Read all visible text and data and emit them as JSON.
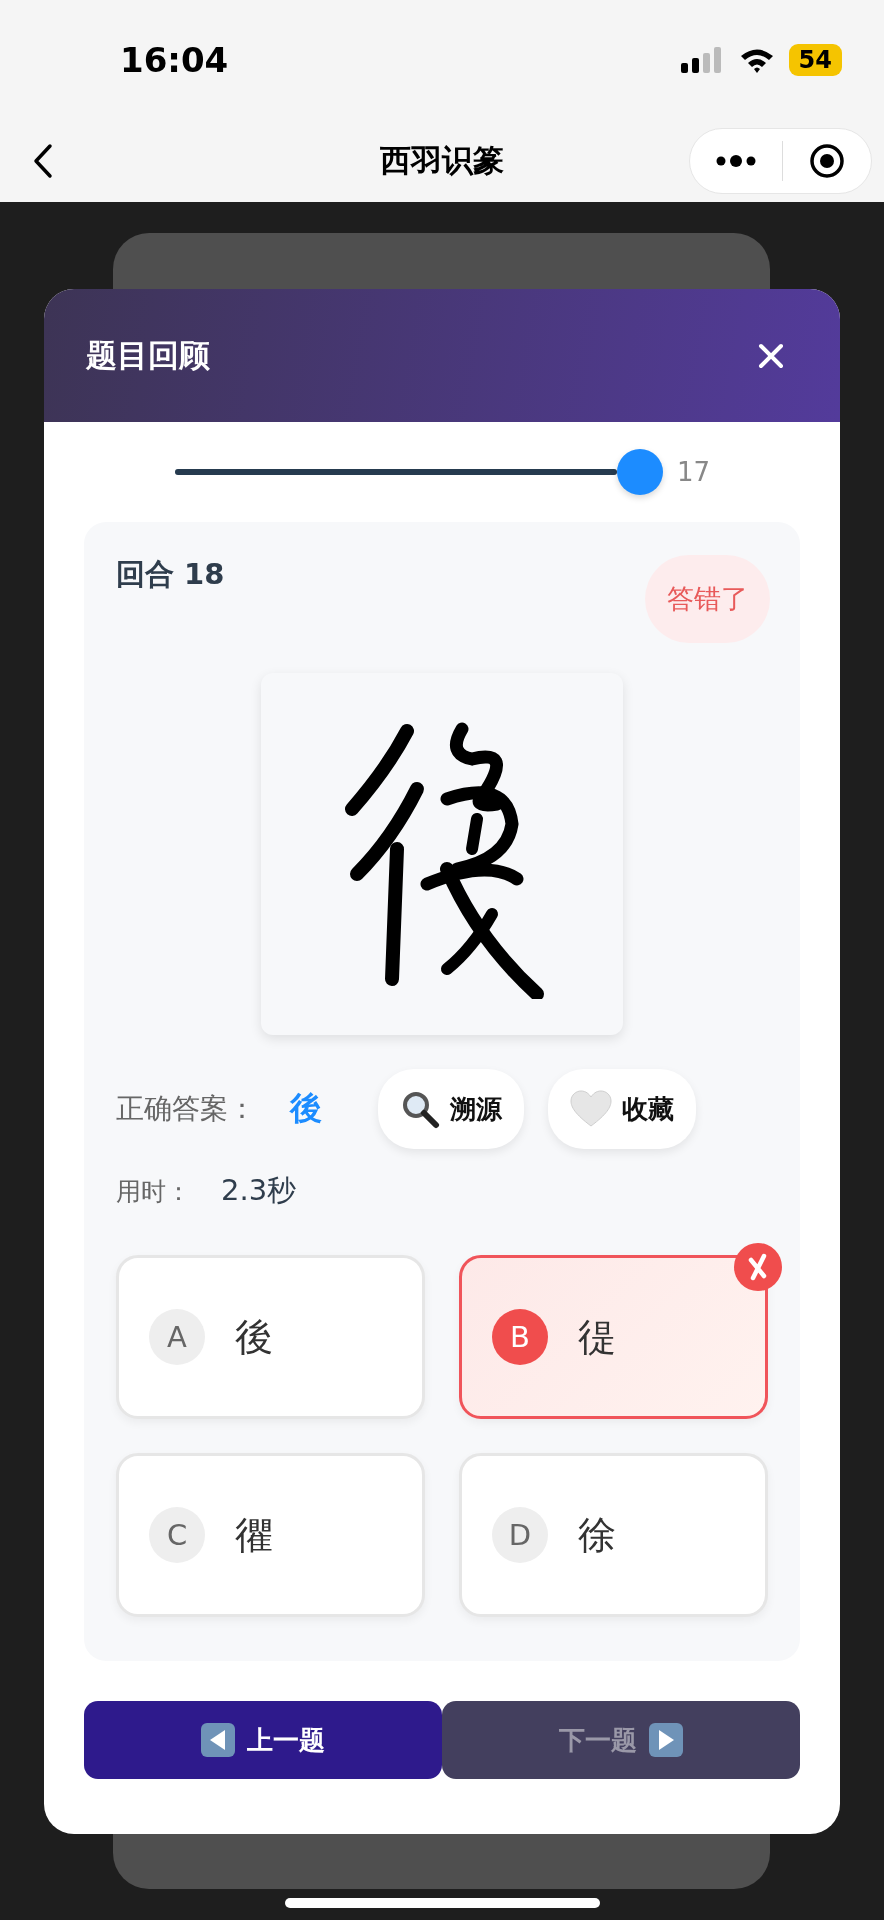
{
  "status_bar": {
    "time": "16:04",
    "battery": "54"
  },
  "nav": {
    "title": "西羽识篆"
  },
  "dialog": {
    "title": "题目回顾",
    "slider": {
      "level": 1,
      "reading": "17"
    },
    "round": "回合 18",
    "result_badge": "答错了",
    "correct_label": "正确答案：",
    "correct_answer": "後",
    "actions": [
      {
        "kind": "search",
        "label": "溯源"
      },
      {
        "kind": "heart",
        "label": "收藏"
      }
    ],
    "time_label": "用时：",
    "time_value": "2.3秒",
    "options": [
      {
        "letter": "A",
        "char": "後",
        "selected": false
      },
      {
        "letter": "B",
        "char": "徥",
        "selected": true
      },
      {
        "letter": "C",
        "char": "忂",
        "selected": false
      },
      {
        "letter": "D",
        "char": "徐",
        "selected": false
      }
    ],
    "nav_buttons": [
      {
        "kind": "prev",
        "label": "上一题",
        "disabled": false
      },
      {
        "kind": "next",
        "label": "下一题",
        "disabled": true
      }
    ]
  }
}
